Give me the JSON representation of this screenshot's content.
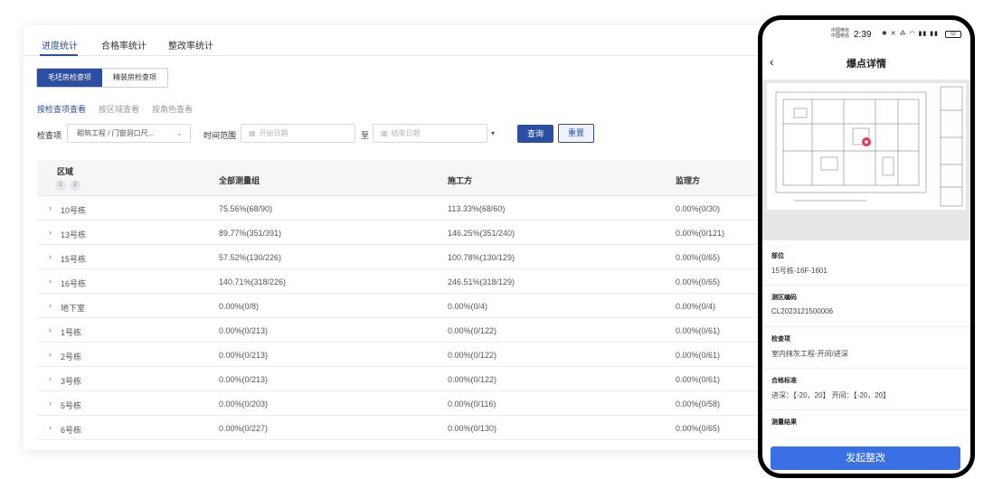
{
  "tabs": [
    {
      "label": "进度统计",
      "active": true
    },
    {
      "label": "合格率统计",
      "active": false
    },
    {
      "label": "整改率统计",
      "active": false
    }
  ],
  "segments": [
    {
      "label": "毛坯房检查项",
      "active": true
    },
    {
      "label": "精装房检查项",
      "active": false
    }
  ],
  "view_links": [
    {
      "label": "按检查项查看",
      "active": true
    },
    {
      "label": "按区域查看",
      "active": false
    },
    {
      "label": "按角色查看",
      "active": false
    }
  ],
  "filters": {
    "check_label": "检查项",
    "check_value": "砌筑工程 / 门窗洞口尺...",
    "time_label": "时间范围",
    "start_placeholder": "开始日期",
    "to_label": "至",
    "end_placeholder": "结束日期",
    "query_label": "查询",
    "reset_label": "重置"
  },
  "table": {
    "headers": {
      "area": "区域",
      "all": "全部测量组",
      "construction": "施工方",
      "supervisor": "监理方"
    },
    "levels": [
      "1",
      "2"
    ],
    "rows": [
      {
        "name": "10号栋",
        "all": "75.56%(68/90)",
        "construction": "113.33%(68/60)",
        "supervisor": "0.00%(0/30)"
      },
      {
        "name": "13号栋",
        "all": "89.77%(351/391)",
        "construction": "146.25%(351/240)",
        "supervisor": "0.00%(0/121)"
      },
      {
        "name": "15号栋",
        "all": "57.52%(130/226)",
        "construction": "100.78%(130/129)",
        "supervisor": "0.00%(0/65)"
      },
      {
        "name": "16号栋",
        "all": "140.71%(318/226)",
        "construction": "246.51%(318/129)",
        "supervisor": "0.00%(0/65)"
      },
      {
        "name": "地下室",
        "all": "0.00%(0/8)",
        "construction": "0.00%(0/4)",
        "supervisor": "0.00%(0/4)"
      },
      {
        "name": "1号栋",
        "all": "0.00%(0/213)",
        "construction": "0.00%(0/122)",
        "supervisor": "0.00%(0/61)"
      },
      {
        "name": "2号栋",
        "all": "0.00%(0/213)",
        "construction": "0.00%(0/122)",
        "supervisor": "0.00%(0/61)"
      },
      {
        "name": "3号栋",
        "all": "0.00%(0/213)",
        "construction": "0.00%(0/122)",
        "supervisor": "0.00%(0/61)"
      },
      {
        "name": "5号栋",
        "all": "0.00%(0/203)",
        "construction": "0.00%(0/116)",
        "supervisor": "0.00%(0/58)"
      },
      {
        "name": "6号栋",
        "all": "0.00%(0/227)",
        "construction": "0.00%(0/130)",
        "supervisor": "0.00%(0/65)"
      }
    ]
  },
  "phone": {
    "carrier": [
      "中国电信",
      "中国电信"
    ],
    "time": "2:39",
    "status_icons": "✱ ✕ ⁂ ◠ ▮▮ ▮▮",
    "battery": "62",
    "title": "爆点详情",
    "fields": [
      {
        "label": "部位",
        "value": "15号栋-16F-1601"
      },
      {
        "label": "测区编码",
        "value": "CL2023121500006"
      },
      {
        "label": "检查项",
        "value": "室内抹灰工程-开间/进深"
      },
      {
        "label": "合格标准",
        "value": "进深：【-20，20】 开间：【-20，20】"
      },
      {
        "label": "测量结果",
        "value": ""
      }
    ],
    "cta_label": "发起整改",
    "accent": "#3a6fe6",
    "marker_color": "#e63a5a"
  },
  "colors": {
    "primary": "#2b4fa3"
  }
}
